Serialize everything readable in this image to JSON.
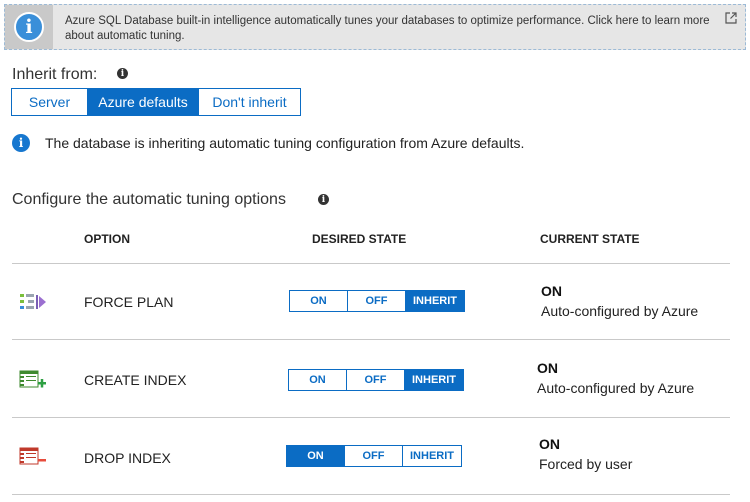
{
  "banner": {
    "icon": "info-icon",
    "text": "Azure SQL Database built-in intelligence automatically tunes your databases to optimize performance. Click here to learn more about automatic tuning.",
    "link_icon": "external-link-icon"
  },
  "inherit": {
    "label": "Inherit from:",
    "options": [
      "Server",
      "Azure defaults",
      "Don't inherit"
    ],
    "selected": "Azure defaults"
  },
  "notice": {
    "text": "The database is inheriting automatic tuning configuration from Azure defaults."
  },
  "configure": {
    "title": "Configure the automatic tuning options"
  },
  "table": {
    "headers": {
      "option": "OPTION",
      "desired": "DESIRED STATE",
      "current": "CURRENT STATE"
    },
    "toggle_labels": [
      "ON",
      "OFF",
      "INHERIT"
    ],
    "rows": [
      {
        "name": "FORCE PLAN",
        "icon": "force-plan-icon",
        "desired": "INHERIT",
        "current_state": "ON",
        "current_desc": "Auto-configured by Azure"
      },
      {
        "name": "CREATE INDEX",
        "icon": "create-index-icon",
        "desired": "INHERIT",
        "current_state": "ON",
        "current_desc": "Auto-configured by Azure"
      },
      {
        "name": "DROP INDEX",
        "icon": "drop-index-icon",
        "desired": "ON",
        "current_state": "ON",
        "current_desc": "Forced by user"
      }
    ]
  },
  "colors": {
    "accent": "#0b6cc4",
    "banner_bg": "#e6e6e6"
  }
}
